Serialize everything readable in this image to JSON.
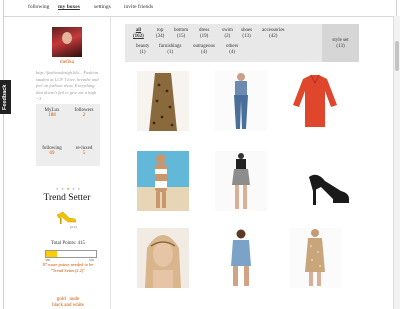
{
  "nav": {
    "items": [
      "following",
      "my boxes",
      "settings",
      "invite friends"
    ],
    "active": "my boxes"
  },
  "feedback_tab": "Feedback",
  "profile": {
    "username": "mefika",
    "bio": "http://fashiondesigh.blo... Fashion student at LCF. I love, breathe and feel on fashion show, Everything that doesn't fail to give me a high <3"
  },
  "stats": {
    "mylux_label": "MyLux",
    "mylux_value": "188",
    "followers_label": "followers",
    "followers_value": "2",
    "following_label": "following",
    "following_value": "69",
    "reluxed_label": "re-luxed",
    "reluxed_value": "5"
  },
  "rank": {
    "title": "Trend Setter",
    "level": "(2.2)"
  },
  "progress": {
    "total_points_label": "Total Points: 415",
    "min": "380",
    "max": "540",
    "fraction": 0.22
  },
  "points_needed": "87 more points needed to be \"Trend Setter(2.2)\"",
  "badges": [
    "gold",
    "nude",
    "black and white"
  ],
  "categories": [
    {
      "label": "all",
      "count": "(162)",
      "active": true
    },
    {
      "label": "top",
      "count": "(34)",
      "active": false
    },
    {
      "label": "bottom",
      "count": "(15)",
      "active": false
    },
    {
      "label": "dress",
      "count": "(19)",
      "active": false
    },
    {
      "label": "swim",
      "count": "(2)",
      "active": false
    },
    {
      "label": "shoes",
      "count": "(13)",
      "active": false
    },
    {
      "label": "accessories",
      "count": "(42)",
      "active": false
    },
    {
      "label": "beauty",
      "count": "(1)",
      "active": false
    },
    {
      "label": "furnishings",
      "count": "(1)",
      "active": false
    },
    {
      "label": "outrageous",
      "count": "(4)",
      "active": false
    },
    {
      "label": "others",
      "count": "(4)",
      "active": false
    }
  ],
  "styleset": {
    "label": "style set",
    "count": "(13)"
  },
  "products": [
    {
      "name": "leopard-maxi-skirt",
      "color": "#8a6a3c"
    },
    {
      "name": "skinny-jeans",
      "color": "#4a6f9a"
    },
    {
      "name": "red-blouse",
      "color": "#e0462c"
    },
    {
      "name": "white-swimsuit",
      "color": "#f4f4f4"
    },
    {
      "name": "sequin-mini-skirt",
      "color": "#8d8d8d"
    },
    {
      "name": "black-heels",
      "color": "#1a1a1a"
    },
    {
      "name": "headband-model",
      "color": "#d9b58c"
    },
    {
      "name": "denim-playsuit",
      "color": "#7ba3c8"
    },
    {
      "name": "sequin-dress",
      "color": "#c8a57a"
    }
  ]
}
